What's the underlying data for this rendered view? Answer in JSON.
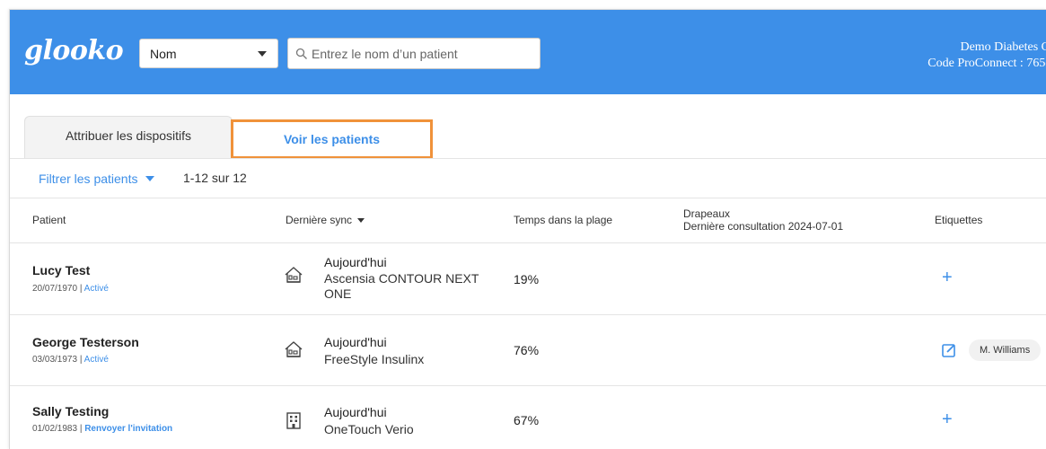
{
  "header": {
    "logo": "glooko",
    "search_type": "Nom",
    "search_placeholder": "Entrez le nom d’un patient",
    "clinic_name": "Demo Diabetes C",
    "proconnect": "Code ProConnect : 765-"
  },
  "tabs": [
    {
      "label": "Attribuer les dispositifs"
    },
    {
      "label": "Voir les patients"
    }
  ],
  "filter": {
    "label": "Filtrer les patients",
    "count": "1-12 sur 12"
  },
  "table": {
    "headers": {
      "patient": "Patient",
      "sync": "Dernière sync",
      "time_in_range": "Temps dans la plage",
      "flags": "Drapeaux",
      "last_visit": "Dernière consultation 2024-07-01",
      "tags": "Etiquettes"
    },
    "rows": [
      {
        "name": "Lucy Test",
        "dob": "20/07/1970 | ",
        "status": "Activé",
        "sync_day": "Aujourd'hui",
        "device": "Ascensia CONTOUR NEXT ONE",
        "sync_icon": "home-icon",
        "tir": "19%",
        "tag": ""
      },
      {
        "name": "George Testerson",
        "dob": "03/03/1973 | ",
        "status": "Activé",
        "sync_day": "Aujourd'hui",
        "device": "FreeStyle Insulinx",
        "sync_icon": "home-icon",
        "tir": "76%",
        "tag": "M. Williams"
      },
      {
        "name": "Sally Testing",
        "dob": "01/02/1983 | ",
        "status": "Renvoyer l'invitation",
        "sync_day": "Aujourd'hui",
        "device": "OneTouch Verio",
        "sync_icon": "clinic-building-icon",
        "tir": "67%",
        "tag": ""
      }
    ],
    "add_tag_symbol": "+"
  },
  "colors": {
    "header_blue": "#3d8fe8",
    "link_blue": "#3d8fe8",
    "highlight_orange": "#f0923a"
  }
}
